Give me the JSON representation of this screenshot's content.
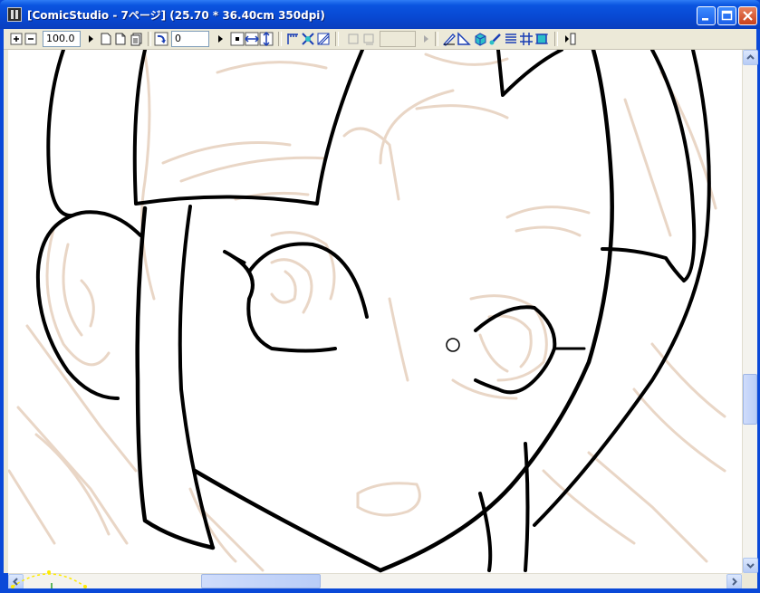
{
  "window": {
    "title": "[ComicStudio - 7ページ] (25.70 * 36.40cm 350dpi)"
  },
  "toolbar": {
    "zoom_value": "100.0",
    "rotation_value": "0",
    "icons": [
      "zoom-in-icon",
      "zoom-out-icon",
      "page-icon",
      "page-flip-icon",
      "page-stack-icon",
      "rotate-icon",
      "fit-center-icon",
      "flip-horizontal-icon",
      "flip-vertical-icon",
      "ruler-icon",
      "grid-icon",
      "perspective-icon",
      "layer-icon",
      "layer-copy-icon",
      "pen-icon",
      "triangle-ruler-icon",
      "cube-icon",
      "brush-icon",
      "lines-icon",
      "hash-icon",
      "frame-icon",
      "panel-toggle-icon"
    ]
  },
  "colors": {
    "title_bar": "#0a55e0",
    "sketch_lines": "#e9d6c6",
    "ink_lines": "#000000",
    "canvas": "#ffffff"
  }
}
